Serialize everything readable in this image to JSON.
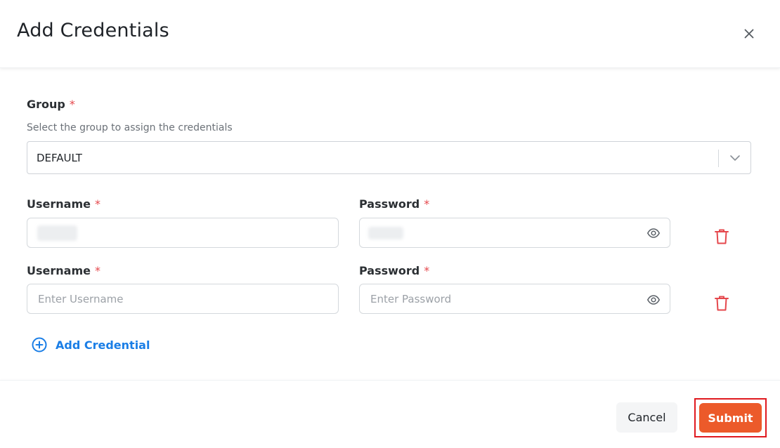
{
  "dialog": {
    "title": "Add Credentials",
    "close_icon": "close-icon"
  },
  "group": {
    "label": "Group",
    "required_mark": "*",
    "hint": "Select the group to assign the credentials",
    "selected": "DEFAULT",
    "chevron_icon": "chevron-down-icon"
  },
  "credentials": [
    {
      "username_label": "Username",
      "password_label": "Password",
      "required_mark": "*",
      "username_value": "",
      "password_value": "",
      "username_placeholder": "",
      "password_placeholder": "",
      "redacted": true
    },
    {
      "username_label": "Username",
      "password_label": "Password",
      "required_mark": "*",
      "username_value": "",
      "password_value": "",
      "username_placeholder": "Enter Username",
      "password_placeholder": "Enter Password",
      "redacted": false
    }
  ],
  "icons": {
    "eye": "eye-icon",
    "trash": "trash-icon",
    "add": "plus-circle-icon"
  },
  "actions": {
    "add_credential": "Add Credential",
    "cancel": "Cancel",
    "submit": "Submit"
  },
  "colors": {
    "accent": "#ec5a2a",
    "link": "#1a7ee6",
    "required": "#e5484d",
    "delete": "#e5484d",
    "highlight": "#e0191f"
  }
}
